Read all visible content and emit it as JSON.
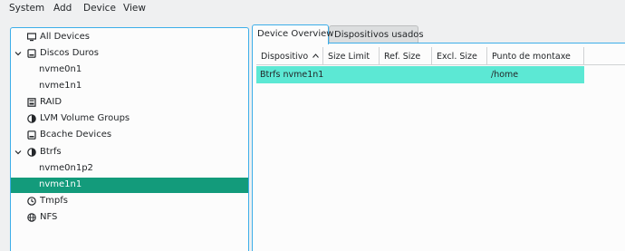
{
  "menubar": {
    "items": [
      {
        "label": "System"
      },
      {
        "label": "Add"
      },
      {
        "label": "Device"
      },
      {
        "label": "View"
      }
    ]
  },
  "tree": {
    "nodes": [
      {
        "label": "All Devices",
        "icon": "monitor-icon",
        "expander": false,
        "selected": false
      },
      {
        "label": "Discos Duros",
        "icon": "hard-disk-icon",
        "expander": true,
        "selected": false
      },
      {
        "label": "nvme0n1",
        "icon": "",
        "expander": false,
        "selected": false
      },
      {
        "label": "nvme1n1",
        "icon": "",
        "expander": false,
        "selected": false
      },
      {
        "label": "RAID",
        "icon": "raid-icon",
        "expander": false,
        "selected": false
      },
      {
        "label": "LVM Volume Groups",
        "icon": "pie-chart-icon",
        "expander": false,
        "selected": false
      },
      {
        "label": "Bcache Devices",
        "icon": "bcache-disk-icon",
        "expander": false,
        "selected": false
      },
      {
        "label": "Btrfs",
        "icon": "pie-chart-icon",
        "expander": true,
        "selected": false
      },
      {
        "label": "nvme0n1p2",
        "icon": "",
        "expander": false,
        "selected": false
      },
      {
        "label": "nvme1n1",
        "icon": "",
        "expander": false,
        "selected": true
      },
      {
        "label": "Tmpfs",
        "icon": "clock-icon",
        "expander": false,
        "selected": false
      },
      {
        "label": "NFS",
        "icon": "globe-icon",
        "expander": false,
        "selected": false
      }
    ]
  },
  "tabs": [
    {
      "label": "Device Overview",
      "active": true
    },
    {
      "label": "Dispositivos usados",
      "active": false
    }
  ],
  "table": {
    "columns": [
      "Dispositivo",
      "Size Limit",
      "Ref. Size",
      "Excl. Size",
      "Punto de montaxe"
    ],
    "rows": [
      [
        "Btrfs nvme1n1",
        "",
        "",
        "",
        "/home"
      ]
    ]
  },
  "colors": {
    "accent": "#3daee9",
    "selection": "#139b7b",
    "row_highlight": "#5ce8d4"
  }
}
